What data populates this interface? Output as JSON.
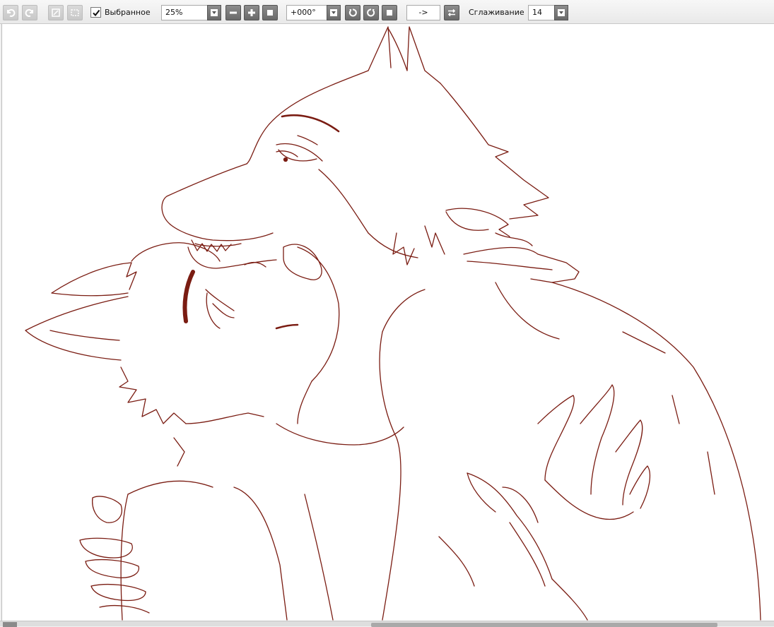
{
  "toolbar": {
    "favorite_label": "Выбранное",
    "favorite_checked": true,
    "zoom_value": "25%",
    "rotation_value": "+000°",
    "flip_label": "->",
    "smoothing_label": "Сглаживание",
    "smoothing_value": "14"
  },
  "colors": {
    "lineart": "#7a1c12",
    "button": "#7a7a7a",
    "canvas": "#ffffff"
  }
}
